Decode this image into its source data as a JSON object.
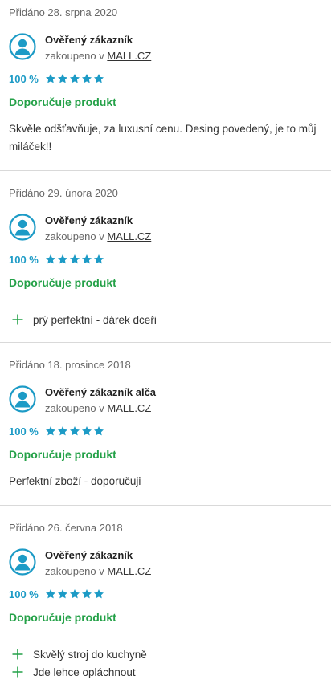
{
  "reviews": [
    {
      "date": "Přidáno 28. srpna 2020",
      "user": "Ověřený zákazník",
      "bought_prefix": "zakoupeno v",
      "shop": "MALL.CZ",
      "rating_percent": "100 %",
      "stars": 5,
      "recommend": "Doporučuje produkt",
      "text": "Skvěle odšťavňuje, za luxusní cenu. Desing povedený, je to můj miláček!!"
    },
    {
      "date": "Přidáno 29. února 2020",
      "user": "Ověřený zákazník",
      "bought_prefix": "zakoupeno v",
      "shop": "MALL.CZ",
      "rating_percent": "100 %",
      "stars": 5,
      "recommend": "Doporučuje produkt",
      "pros": [
        "prý perfektní - dárek dceři"
      ]
    },
    {
      "date": "Přidáno 18. prosince 2018",
      "user": "Ověřený zákazník alča",
      "bought_prefix": "zakoupeno v",
      "shop": "MALL.CZ",
      "rating_percent": "100 %",
      "stars": 5,
      "recommend": "Doporučuje produkt",
      "text": "Perfektní zboží - doporučuji"
    },
    {
      "date": "Přidáno 26. června 2018",
      "user": "Ověřený zákazník",
      "bought_prefix": "zakoupeno v",
      "shop": "MALL.CZ",
      "rating_percent": "100 %",
      "stars": 5,
      "recommend": "Doporučuje produkt",
      "pros": [
        "Skvělý stroj do kuchyně",
        "Jde lehce opláchnout"
      ]
    }
  ],
  "colors": {
    "accent_blue": "#1d9bc6",
    "recommend_green": "#24a148",
    "divider": "#d9d9d9"
  },
  "icons": {
    "avatar": "user-avatar-icon",
    "star": "star-icon",
    "pro": "plus-icon"
  }
}
